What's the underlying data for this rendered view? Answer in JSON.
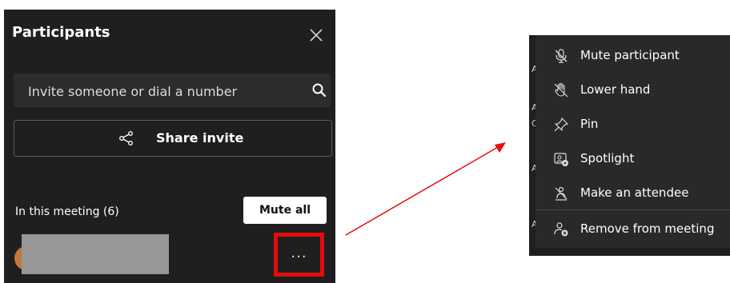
{
  "panel": {
    "title": "Participants",
    "search_placeholder": "Invite someone or dial a number",
    "share_label": "Share invite",
    "meeting_label": "In this meeting (6)",
    "mute_all_label": "Mute all",
    "more_label": "..."
  },
  "menu": {
    "items": [
      {
        "label": "Mute participant",
        "icon": "mic-off-icon"
      },
      {
        "label": "Lower hand",
        "icon": "hand-off-icon"
      },
      {
        "label": "Pin",
        "icon": "pin-icon"
      },
      {
        "label": "Spotlight",
        "icon": "spotlight-icon"
      },
      {
        "label": "Make an attendee",
        "icon": "make-attendee-icon"
      },
      {
        "label": "Remove from meeting",
        "icon": "remove-person-icon"
      }
    ],
    "edge_letters": [
      "A",
      "A",
      "C",
      "A",
      "A"
    ]
  },
  "colors": {
    "panel_bg": "#1f1f1f",
    "menu_bg": "#292929",
    "highlight": "#e30d0d"
  }
}
